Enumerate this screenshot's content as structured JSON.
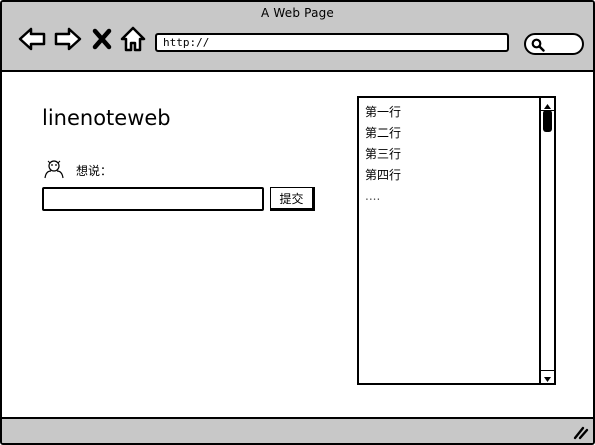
{
  "window": {
    "title": "A Web Page",
    "url": "http://"
  },
  "icons": {
    "back": "back-arrow-icon",
    "forward": "forward-arrow-icon",
    "stop": "close-icon",
    "home": "home-icon",
    "search": "search-icon",
    "user": "user-icon",
    "scroll_up": "chevron-up-icon",
    "scroll_down": "chevron-down-icon",
    "resize": "resize-grip-icon"
  },
  "page": {
    "title": "linenoteweb",
    "say_label": "想说：",
    "input_value": "",
    "submit_label": "提交",
    "lines": [
      "第一行",
      "第二行",
      "第三行",
      "第四行"
    ],
    "more": "....",
    "scroll_position": 0
  },
  "colors": {
    "chrome": "#c8c8c8",
    "border": "#000000",
    "background": "#ffffff"
  }
}
